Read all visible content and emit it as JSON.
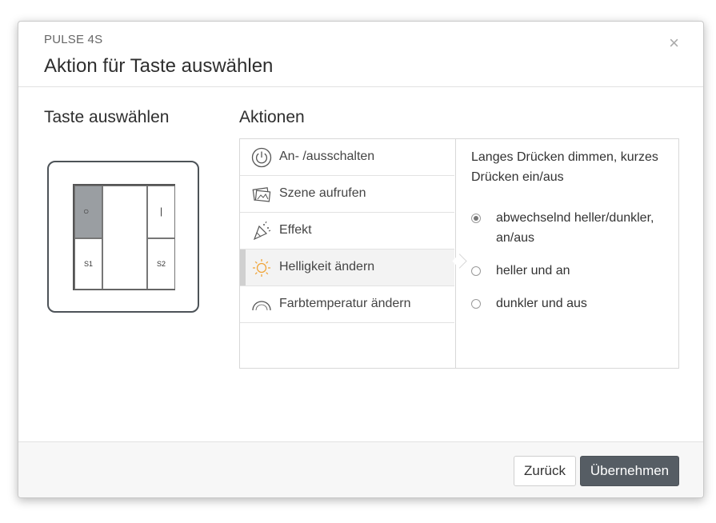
{
  "dialog": {
    "subtitle": "PULSE 4S",
    "title": "Aktion für Taste auswählen",
    "close_glyph": "×"
  },
  "select_key": {
    "heading": "Taste auswählen",
    "keys": {
      "power_glyph": "○",
      "pipe_glyph": "|",
      "s1": "S1",
      "s2": "S2"
    },
    "selected_key": "top-left"
  },
  "actions": {
    "heading": "Aktionen",
    "items": [
      {
        "label": "An- /ausschalten",
        "icon": "power-icon"
      },
      {
        "label": "Szene aufrufen",
        "icon": "scene-icon"
      },
      {
        "label": "Effekt",
        "icon": "confetti-icon"
      },
      {
        "label": "Helligkeit ändern",
        "icon": "sun-icon",
        "active": true
      },
      {
        "label": "Farbtemperatur ändern",
        "icon": "color-temperature-icon"
      }
    ],
    "description": "Langes Drücken dimmen, kurzes Drücken ein/aus",
    "options": [
      {
        "label": "abwechselnd heller/dunkler, an/aus",
        "checked": true
      },
      {
        "label": "heller und an",
        "checked": false
      },
      {
        "label": "dunkler und aus",
        "checked": false
      }
    ]
  },
  "footer": {
    "back_label": "Zurück",
    "apply_label": "Übernehmen"
  },
  "colors": {
    "primary_button": "#565d64",
    "sun_icon": "#f0a53a",
    "selected_key": "#9a9ea2",
    "led": "#e03030"
  }
}
